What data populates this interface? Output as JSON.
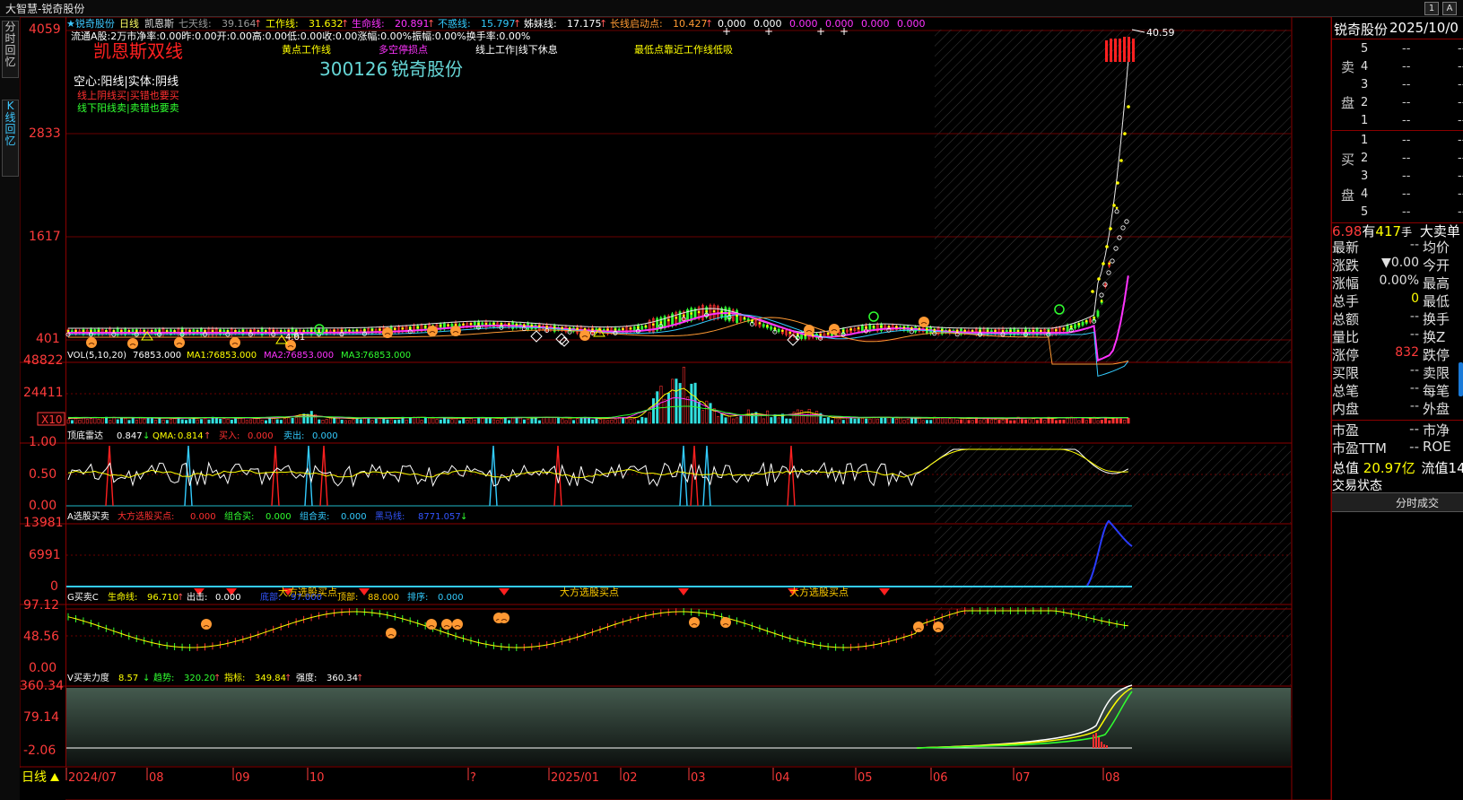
{
  "window_title": "大智慧-锐奇股份",
  "window_buttons": [
    "1",
    "A"
  ],
  "left_tabs": [
    "分时回忆",
    "K线回忆"
  ],
  "main": {
    "header_line1": {
      "star_name": "★锐奇股份",
      "period": "日线",
      "indicator": "凯恩斯",
      "items": [
        {
          "label": "七天线:",
          "value": "39.164",
          "arrow": "↑"
        },
        {
          "label": "工作线:",
          "value": "31.632",
          "arrow": "↑"
        },
        {
          "label": "生命线:",
          "value": "20.891",
          "arrow": "↑"
        },
        {
          "label": "不惑线:",
          "value": "15.797",
          "arrow": "↑"
        },
        {
          "label": "姊妹线:",
          "value": "17.175",
          "arrow": "↑"
        },
        {
          "label": "长线启动点:",
          "value": "10.427",
          "arrow": "↑"
        }
      ],
      "tail": [
        "0.000",
        "0.000",
        "0.000",
        "0.000",
        "0.000",
        "0.000"
      ]
    },
    "header_line2": "流通A股:2万市净率:0.00昨:0.00开:0.00高:0.00低:0.00收:0.00涨幅:0.00%振幅:0.00%换手率:0.00%",
    "legend": {
      "title": "凯恩斯双线",
      "yellow_dot": "黄点工作线",
      "stop_loss": "多空停损点",
      "work_rest": "线上工作|线下休息",
      "lowest": "最低点靠近工作线低吸",
      "code": "300126",
      "name": "锐奇股份",
      "hollow": "空心:阳线|实体:阴线",
      "red_rule": "线上阴线买|买错也要买",
      "green_rule": "线下阳线卖|卖错也要卖"
    },
    "price_axis": [
      "4059",
      "2833",
      "1617",
      "401"
    ],
    "peak_label": "40.59",
    "low_label": "4.01",
    "vol_panel": {
      "title": "VOL(5,10,20)",
      "v": "76853.000",
      "ma1_label": "MA1:",
      "ma1": "76853.000",
      "ma2_label": "MA2:",
      "ma2": "76853.000",
      "ma3_label": "MA3:",
      "ma3": "76853.000",
      "axis": [
        "48822",
        "24411"
      ],
      "unit": "X10"
    },
    "radar_panel": {
      "title": "顶底雷达",
      "v1": "0.847",
      "v1_arrow": "↓",
      "qma_label": "QMA:",
      "qma": "0.814",
      "qma_arrow": "↑",
      "buy_label": "买入:",
      "buy": "0.000",
      "sell_label": "卖出:",
      "sell": "0.000",
      "axis": [
        "1.00",
        "0.50",
        "0.00"
      ]
    },
    "pick_panel": {
      "title": "A选股买卖",
      "dafang_label": "大方选股买点:",
      "dafang": "0.000",
      "combo_buy_label": "组合买:",
      "combo_buy": "0.000",
      "combo_sell_label": "组合卖:",
      "combo_sell": "0.000",
      "black_horse_label": "黑马线:",
      "black_horse": "8771.057",
      "black_horse_arrow": "↓",
      "axis": [
        "13981",
        "6991",
        "0"
      ],
      "signal_text": "大方选股买点"
    },
    "c_panel": {
      "title": "G买卖C",
      "life_label": "生命线:",
      "life": "96.710",
      "life_arrow": "↑",
      "out_label": "出击:",
      "out": "0.000",
      "bottom_label": "底部:",
      "bottom": "97.000",
      "top_label": "顶部:",
      "top": "88.000",
      "order_label": "排序:",
      "order": "0.000",
      "axis": [
        "97.12",
        "48.56",
        "0.00"
      ]
    },
    "force_panel": {
      "title": "V买卖力度",
      "v1": "8.57",
      "v1_arrow": "↓",
      "trend_label": "趋势:",
      "trend": "320.20",
      "trend_arrow": "↑",
      "index_label": "指标:",
      "index": "349.84",
      "index_arrow": "↑",
      "strength_label": "强度:",
      "strength": "360.34",
      "strength_arrow": "↑",
      "axis": [
        "360.34",
        "79.14",
        "-2.06"
      ]
    },
    "bottom_left_label": "日线",
    "date_axis": [
      "2024/07",
      "08",
      "09",
      "10",
      "?",
      "2025/01",
      "02",
      "03",
      "04",
      "05",
      "06",
      "07",
      "08"
    ]
  },
  "right_panel": {
    "header_name": "锐奇股份",
    "header_date": "2025/10/0",
    "sell_label": [
      "卖",
      "盘"
    ],
    "buy_label": [
      "买",
      "盘"
    ],
    "levels": [
      "5",
      "4",
      "3",
      "2",
      "1"
    ],
    "buy_levels": [
      "1",
      "2",
      "3",
      "4",
      "5"
    ],
    "dash": "--",
    "big_order": {
      "price": "6.98",
      "has": "有",
      "qty": "417",
      "unit": "手",
      "tag": "大卖单"
    },
    "quote_rows": [
      {
        "l": "最新",
        "lv": "--",
        "r": "均价",
        "lc": "#c8c8c8"
      },
      {
        "l": "涨跌",
        "lv": "▼0.00",
        "r": "今开",
        "lc": "#e0e0e0"
      },
      {
        "l": "涨幅",
        "lv": "0.00%",
        "r": "最高",
        "lc": "#e0e0e0"
      },
      {
        "l": "总手",
        "lv": "0",
        "r": "最低",
        "lc": "#ffff00"
      },
      {
        "l": "总额",
        "lv": "--",
        "r": "换手",
        "lc": "#c8c8c8"
      },
      {
        "l": "量比",
        "lv": "--",
        "r": "换Z",
        "lc": "#c8c8c8"
      },
      {
        "l": "涨停",
        "lv": "832",
        "r": "跌停",
        "lc": "#ff3b3b"
      },
      {
        "l": "买限",
        "lv": "--",
        "r": "卖限",
        "lc": "#c8c8c8"
      },
      {
        "l": "总笔",
        "lv": "--",
        "r": "每笔",
        "lc": "#c8c8c8"
      },
      {
        "l": "内盘",
        "lv": "--",
        "r": "外盘",
        "lc": "#c8c8c8"
      }
    ],
    "pe_rows": [
      {
        "l": "市盈",
        "lv": "--",
        "r": "市净"
      },
      {
        "l": "市盈TTM",
        "lv": "--",
        "r": "ROE"
      }
    ],
    "mktcap_label": "总值",
    "mktcap": "20.97亿",
    "float_label": "流值",
    "float_val": "14",
    "trade_state": "交易状态",
    "tick_tab": "分时成交"
  }
}
